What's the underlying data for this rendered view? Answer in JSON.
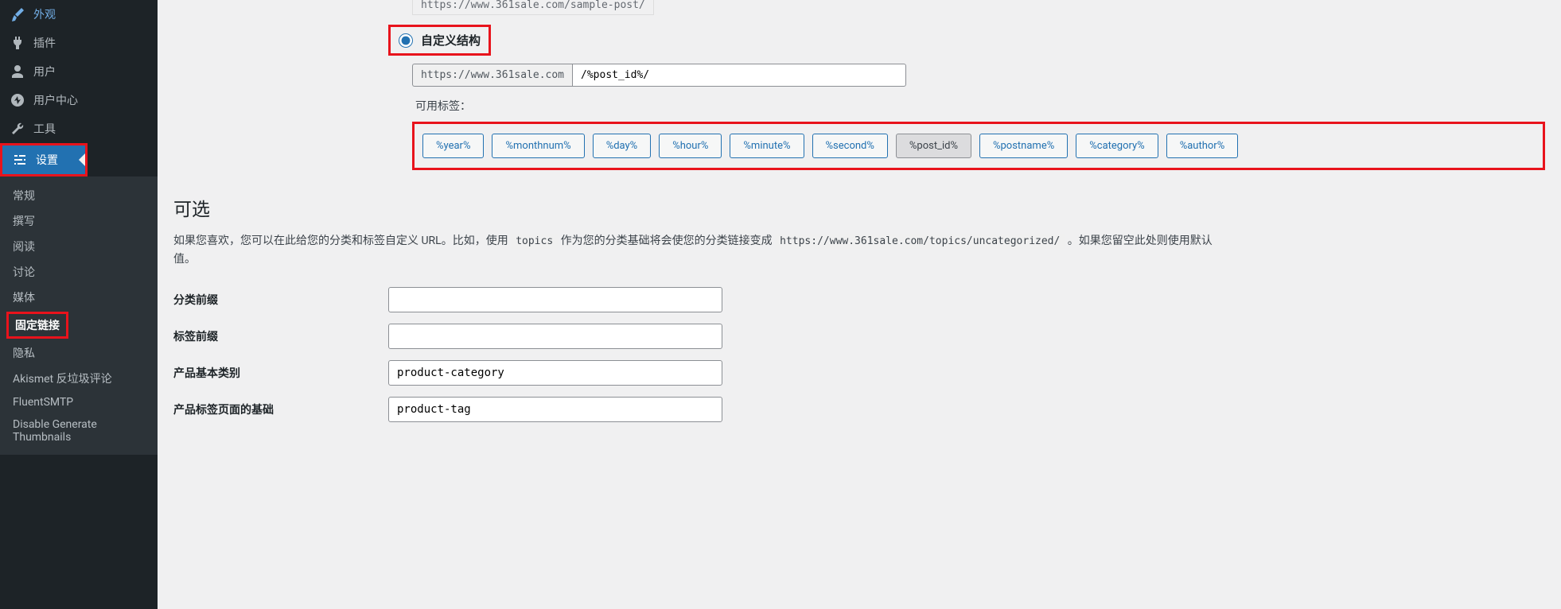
{
  "sidebar": {
    "top_items": [
      {
        "label": "外观",
        "icon": "brush"
      },
      {
        "label": "插件",
        "icon": "plug"
      },
      {
        "label": "用户",
        "icon": "user"
      },
      {
        "label": "用户中心",
        "icon": "dashboard"
      },
      {
        "label": "工具",
        "icon": "wrench"
      },
      {
        "label": "设置",
        "icon": "sliders"
      }
    ],
    "submenu": [
      {
        "label": "常规"
      },
      {
        "label": "撰写"
      },
      {
        "label": "阅读"
      },
      {
        "label": "讨论"
      },
      {
        "label": "媒体"
      },
      {
        "label": "固定链接"
      },
      {
        "label": "隐私"
      },
      {
        "label": "Akismet 反垃圾评论"
      },
      {
        "label": "FluentSMTP"
      },
      {
        "label": "Disable Generate Thumbnails"
      }
    ]
  },
  "permalink": {
    "sample_url": "https://www.361sale.com/sample-post/",
    "custom_label": "自定义结构",
    "url_prefix": "https://www.361sale.com",
    "url_value": "/%post_id%/",
    "tags_label": "可用标签：",
    "tags": [
      "%year%",
      "%monthnum%",
      "%day%",
      "%hour%",
      "%minute%",
      "%second%",
      "%post_id%",
      "%postname%",
      "%category%",
      "%author%"
    ],
    "active_tag": "%post_id%"
  },
  "optional": {
    "heading": "可选",
    "desc_1": "如果您喜欢，您可以在此给您的分类和标签自定义 URL。比如，使用 ",
    "desc_code1": "topics",
    "desc_2": " 作为您的分类基础将会使您的分类链接变成 ",
    "desc_code2": "https://www.361sale.com/topics/uncategorized/",
    "desc_3": " 。如果您留空此处则使用默认",
    "desc_4": "值。",
    "rows": [
      {
        "label": "分类前缀",
        "value": ""
      },
      {
        "label": "标签前缀",
        "value": ""
      },
      {
        "label": "产品基本类别",
        "value": "product-category"
      },
      {
        "label": "产品标签页面的基础",
        "value": "product-tag"
      }
    ]
  }
}
